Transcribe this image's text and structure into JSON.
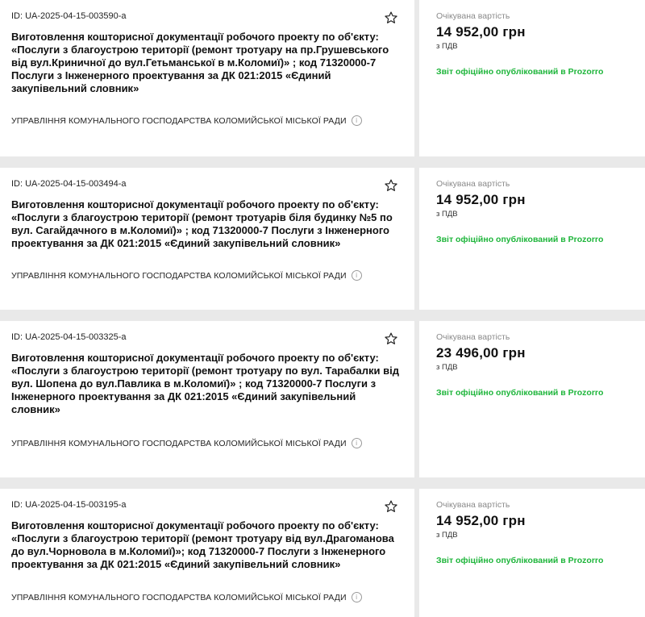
{
  "labels": {
    "expected_value": "Очікувана вартість",
    "vat": "з ПДВ",
    "report_status": "Звіт офіційно опублікований в Prozorro"
  },
  "icons": {
    "favorite": "star-outline-icon",
    "info": "info-circle-icon"
  },
  "colors": {
    "report_green": "#1db53a",
    "background": "#e9e9e9"
  },
  "tenders": [
    {
      "id": "ID: UA-2025-04-15-003590-a",
      "title": "Виготовлення кошторисної документації робочого проекту по об'єкту: «Послуги з благоустрою території (ремонт тротуару на пр.Грушевського від вул.Криничної до вул.Гетьманської в м.Коломиї)» ; код 71320000-7 Послуги з Інженерного проектування за ДК 021:2015 «Єдиний закупівельний словник»",
      "organization": "УПРАВЛІННЯ КОМУНАЛЬНОГО ГОСПОДАРСТВА КОЛОМИЙСЬКОЇ МІСЬКОЇ РАДИ",
      "price": "14 952,00 грн"
    },
    {
      "id": "ID: UA-2025-04-15-003494-a",
      "title": "Виготовлення кошторисної документації робочого проекту по об'єкту: «Послуги з благоустрою території (ремонт тротуарів біля будинку №5 по вул. Сагайдачного в м.Коломиї)» ; код 71320000-7 Послуги з Інженерного проектування за ДК 021:2015 «Єдиний закупівельний словник»",
      "organization": "УПРАВЛІННЯ КОМУНАЛЬНОГО ГОСПОДАРСТВА КОЛОМИЙСЬКОЇ МІСЬКОЇ РАДИ",
      "price": "14 952,00 грн"
    },
    {
      "id": "ID: UA-2025-04-15-003325-a",
      "title": "Виготовлення кошторисної документації робочого проекту по об'єкту: «Послуги з благоустрою території (ремонт тротуару по вул. Тарабалки від вул. Шопена до вул.Павлика в м.Коломиї)» ; код 71320000-7 Послуги з Інженерного проектування за ДК 021:2015 «Єдиний закупівельний словник»",
      "organization": "УПРАВЛІННЯ КОМУНАЛЬНОГО ГОСПОДАРСТВА КОЛОМИЙСЬКОЇ МІСЬКОЇ РАДИ",
      "price": "23 496,00 грн"
    },
    {
      "id": "ID: UA-2025-04-15-003195-a",
      "title": "Виготовлення кошторисної документації робочого проекту по об'єкту: «Послуги з благоустрою території (ремонт тротуару від вул.Драгоманова до вул.Чорновола в м.Коломиї)»; код 71320000-7 Послуги з Інженерного проектування за ДК 021:2015 «Єдиний закупівельний словник»",
      "organization": "УПРАВЛІННЯ КОМУНАЛЬНОГО ГОСПОДАРСТВА КОЛОМИЙСЬКОЇ МІСЬКОЇ РАДИ",
      "price": "14 952,00 грн"
    }
  ]
}
